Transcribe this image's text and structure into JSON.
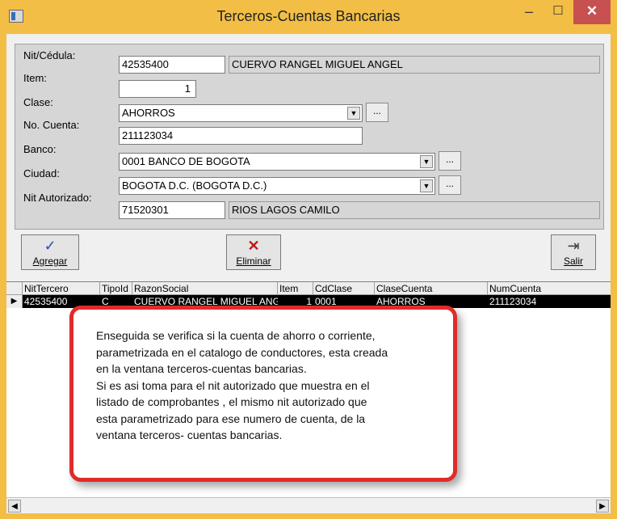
{
  "window": {
    "title": "Terceros-Cuentas Bancarias",
    "min_glyph": "–",
    "max_glyph": "☐",
    "close_glyph": "✕"
  },
  "form": {
    "nit_label": "Nit/Cédula:",
    "nit_value": "42535400",
    "nit_name": "CUERVO RANGEL MIGUEL ANGEL",
    "item_label": "Item:",
    "item_value": "1",
    "clase_label": "Clase:",
    "clase_value": "AHORROS",
    "cuenta_label": "No. Cuenta:",
    "cuenta_value": "211123034",
    "banco_label": "Banco:",
    "banco_value": "0001  BANCO DE BOGOTA",
    "ciudad_label": "Ciudad:",
    "ciudad_value": "BOGOTA D.C.  (BOGOTA D.C.)",
    "autorizado_label": "Nit Autorizado:",
    "autorizado_value": "71520301",
    "autorizado_name": "RIOS LAGOS CAMILO",
    "ellipsis": "..."
  },
  "toolbar": {
    "agregar_label": "Agregar",
    "eliminar_label": "Eliminar",
    "salir_label": "Salir"
  },
  "grid": {
    "columns": [
      "NitTercero",
      "TipoId",
      "RazonSocial",
      "Item",
      "CdClase",
      "ClaseCuenta",
      "NumCuenta"
    ],
    "rows": [
      {
        "indicator": "▶",
        "NitTercero": "42535400",
        "TipoId": "C",
        "RazonSocial": "CUERVO RANGEL MIGUEL ANG",
        "Item": "1",
        "CdClase": "0001",
        "ClaseCuenta": "AHORROS",
        "NumCuenta": "211123034"
      }
    ]
  },
  "callout": {
    "lines": [
      "Enseguida se verifica si la cuenta de ahorro o corriente,",
      "parametrizada en el catalogo de conductores, esta creada",
      "en la ventana terceros-cuentas bancarias.",
      "Si es asi toma para el nit autorizado que muestra en el",
      "listado de comprobantes , el mismo nit autorizado que",
      "esta parametrizado para ese numero de cuenta, de la",
      "ventana terceros- cuentas bancarias."
    ]
  },
  "colors": {
    "titlebar": "#f2be45",
    "close_button": "#c75050",
    "callout_border": "#e02b2b",
    "selected_row": "#000000"
  },
  "icons": {
    "agregar": "checkmark-icon",
    "eliminar": "x-icon",
    "salir": "exit-door-icon"
  }
}
